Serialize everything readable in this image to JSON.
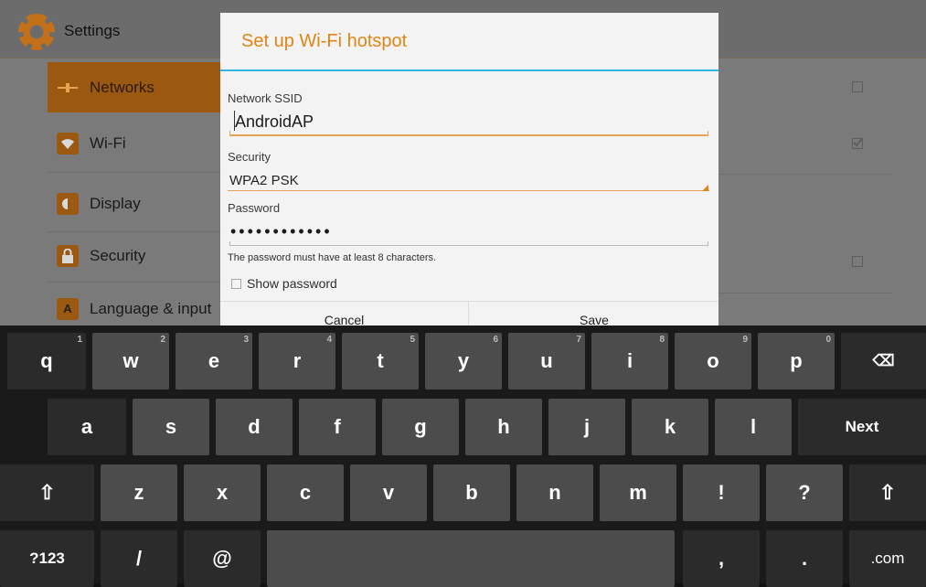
{
  "settings": {
    "title": "Settings",
    "items": [
      {
        "label": "Networks",
        "icon": "networks-icon",
        "selected": true
      },
      {
        "label": "Wi-Fi",
        "icon": "wifi-icon",
        "selected": false
      },
      {
        "label": "Display",
        "icon": "display-icon",
        "selected": false
      },
      {
        "label": "Security",
        "icon": "lock-icon",
        "selected": false
      },
      {
        "label": "Language & input",
        "icon": "language-icon",
        "selected": false
      }
    ],
    "checkboxes": [
      {
        "checked": false
      },
      {
        "checked": true
      },
      {
        "checked": false
      }
    ]
  },
  "dialog": {
    "title": "Set up Wi-Fi hotspot",
    "ssid_label": "Network SSID",
    "ssid_value": "AndroidAP",
    "security_label": "Security",
    "security_value": "WPA2 PSK",
    "password_label": "Password",
    "password_value": "••••••••••••",
    "hint": "The password must have at least 8 characters.",
    "show_password_label": "Show password",
    "show_password_checked": false,
    "cancel_label": "Cancel",
    "save_label": "Save"
  },
  "keyboard": {
    "row1": [
      {
        "label": "q",
        "sub": "1"
      },
      {
        "label": "w",
        "sub": "2"
      },
      {
        "label": "e",
        "sub": "3"
      },
      {
        "label": "r",
        "sub": "4"
      },
      {
        "label": "t",
        "sub": "5"
      },
      {
        "label": "y",
        "sub": "6"
      },
      {
        "label": "u",
        "sub": "7"
      },
      {
        "label": "i",
        "sub": "8"
      },
      {
        "label": "o",
        "sub": "9"
      },
      {
        "label": "p",
        "sub": "0"
      },
      {
        "label": "⌫",
        "sub": ""
      }
    ],
    "row2": [
      {
        "label": "a"
      },
      {
        "label": "s"
      },
      {
        "label": "d"
      },
      {
        "label": "f"
      },
      {
        "label": "g"
      },
      {
        "label": "h"
      },
      {
        "label": "j"
      },
      {
        "label": "k"
      },
      {
        "label": "l"
      },
      {
        "label": "Next"
      }
    ],
    "row3": [
      {
        "label": "⇧"
      },
      {
        "label": "z"
      },
      {
        "label": "x"
      },
      {
        "label": "c"
      },
      {
        "label": "v"
      },
      {
        "label": "b"
      },
      {
        "label": "n"
      },
      {
        "label": "m"
      },
      {
        "label": "!"
      },
      {
        "label": "?"
      },
      {
        "label": "⇧"
      }
    ],
    "row4": [
      {
        "label": "?123"
      },
      {
        "label": "/"
      },
      {
        "label": "@"
      },
      {
        "label": " "
      },
      {
        "label": ","
      },
      {
        "label": "."
      },
      {
        "label": ".com"
      }
    ]
  },
  "colors": {
    "accent": "#e08512",
    "divider": "#33b5e5",
    "selected_item": "#9b5810",
    "key": "#4c4c4c"
  }
}
